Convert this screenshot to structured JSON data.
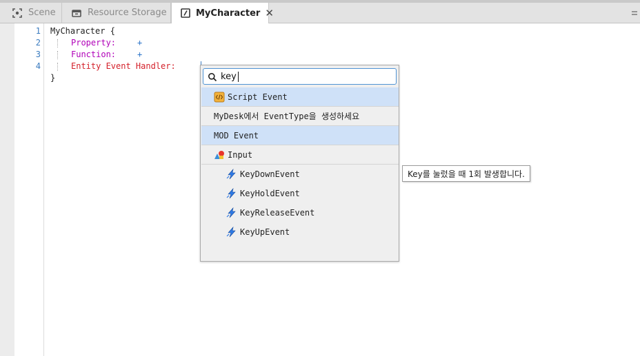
{
  "tabs": [
    {
      "label": "Scene",
      "icon": "scene-focus-icon"
    },
    {
      "label": "Resource Storage",
      "icon": "storage-box-icon"
    },
    {
      "label": "MyCharacter",
      "icon": "script-slash-icon"
    }
  ],
  "tab_close_glyph": "✕",
  "editor": {
    "line_numbers": [
      "1",
      "2",
      "3",
      "4"
    ],
    "line1": "MyCharacter {",
    "property_label": "Property:",
    "function_label": "Function:",
    "entity_event_label": "Entity Event Handler:",
    "add_glyph": "+",
    "closing": "}"
  },
  "popup": {
    "search_value": "key",
    "items": [
      {
        "label": "Script Event",
        "icon": "script-event-icon"
      },
      {
        "label": "MyDesk에서 EventType을 생성하세요"
      },
      {
        "label": "MOD Event"
      },
      {
        "label": "Input",
        "icon": "input-shapes-icon"
      },
      {
        "label": "KeyDownEvent",
        "icon": "lightning-event-icon"
      },
      {
        "label": "KeyHoldEvent",
        "icon": "lightning-event-icon"
      },
      {
        "label": "KeyReleaseEvent",
        "icon": "lightning-event-icon"
      },
      {
        "label": "KeyUpEvent",
        "icon": "lightning-event-icon"
      }
    ]
  },
  "tooltip": "Key를 눌렀을 때 1회 발생합니다.",
  "colors": {
    "accent": "#4f93d4",
    "highlight_row": "#cfe1f8",
    "keyword_magenta": "#b000b8",
    "keyword_red": "#d4202a",
    "plus_blue": "#2a73c8"
  }
}
